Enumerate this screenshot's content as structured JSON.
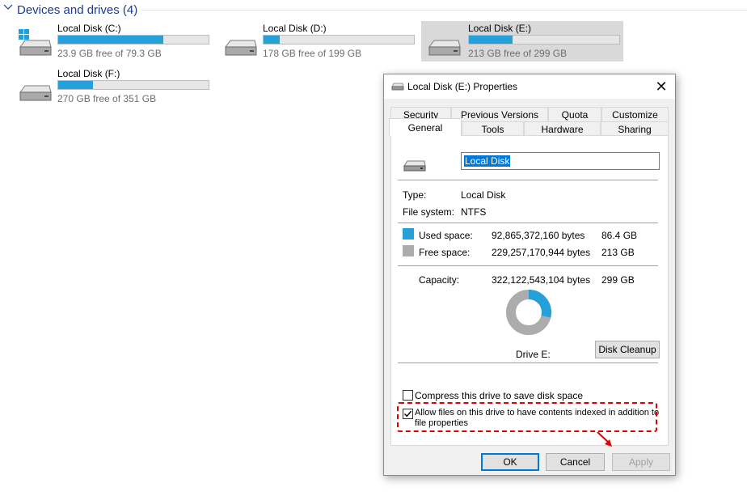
{
  "explorer": {
    "section_title": "Devices and drives (4)",
    "drives": [
      {
        "name": "Local Disk (C:)",
        "free": "23.9 GB free of 79.3 GB",
        "used_fraction": 0.7,
        "windows": true
      },
      {
        "name": "Local Disk (D:)",
        "free": "178 GB free of 199 GB",
        "used_fraction": 0.11
      },
      {
        "name": "Local Disk (E:)",
        "free": "213 GB free of 299 GB",
        "used_fraction": 0.29,
        "selected": true
      },
      {
        "name": "Local Disk (F:)",
        "free": "270 GB free of 351 GB",
        "used_fraction": 0.23
      }
    ]
  },
  "dialog": {
    "title": "Local Disk (E:) Properties",
    "tabs_row1": [
      "Security",
      "Previous Versions",
      "Quota",
      "Customize"
    ],
    "tabs_row2": [
      "General",
      "Tools",
      "Hardware",
      "Sharing"
    ],
    "active_tab": "General",
    "volume_name": "Local Disk",
    "type_label": "Type:",
    "type_value": "Local Disk",
    "fs_label": "File system:",
    "fs_value": "NTFS",
    "used_label": "Used space:",
    "used_bytes": "92,865,372,160 bytes",
    "used_gb": "86.4 GB",
    "free_label": "Free space:",
    "free_bytes": "229,257,170,944 bytes",
    "free_gb": "213 GB",
    "capacity_label": "Capacity:",
    "capacity_bytes": "322,122,543,104 bytes",
    "capacity_gb": "299 GB",
    "drive_label": "Drive E:",
    "disk_cleanup": "Disk Cleanup",
    "compress_label": "Compress this drive to save disk space",
    "compress_checked": false,
    "index_label_line1": "Allow files on this drive to have contents indexed in addition to",
    "index_label_line2": "file properties",
    "index_checked": true,
    "ok": "OK",
    "cancel": "Cancel",
    "apply": "Apply",
    "used_fraction": 0.288
  },
  "colors": {
    "used": "#26a0da",
    "free": "#acacac",
    "annotation": "#e00000",
    "accent": "#0078d7"
  }
}
